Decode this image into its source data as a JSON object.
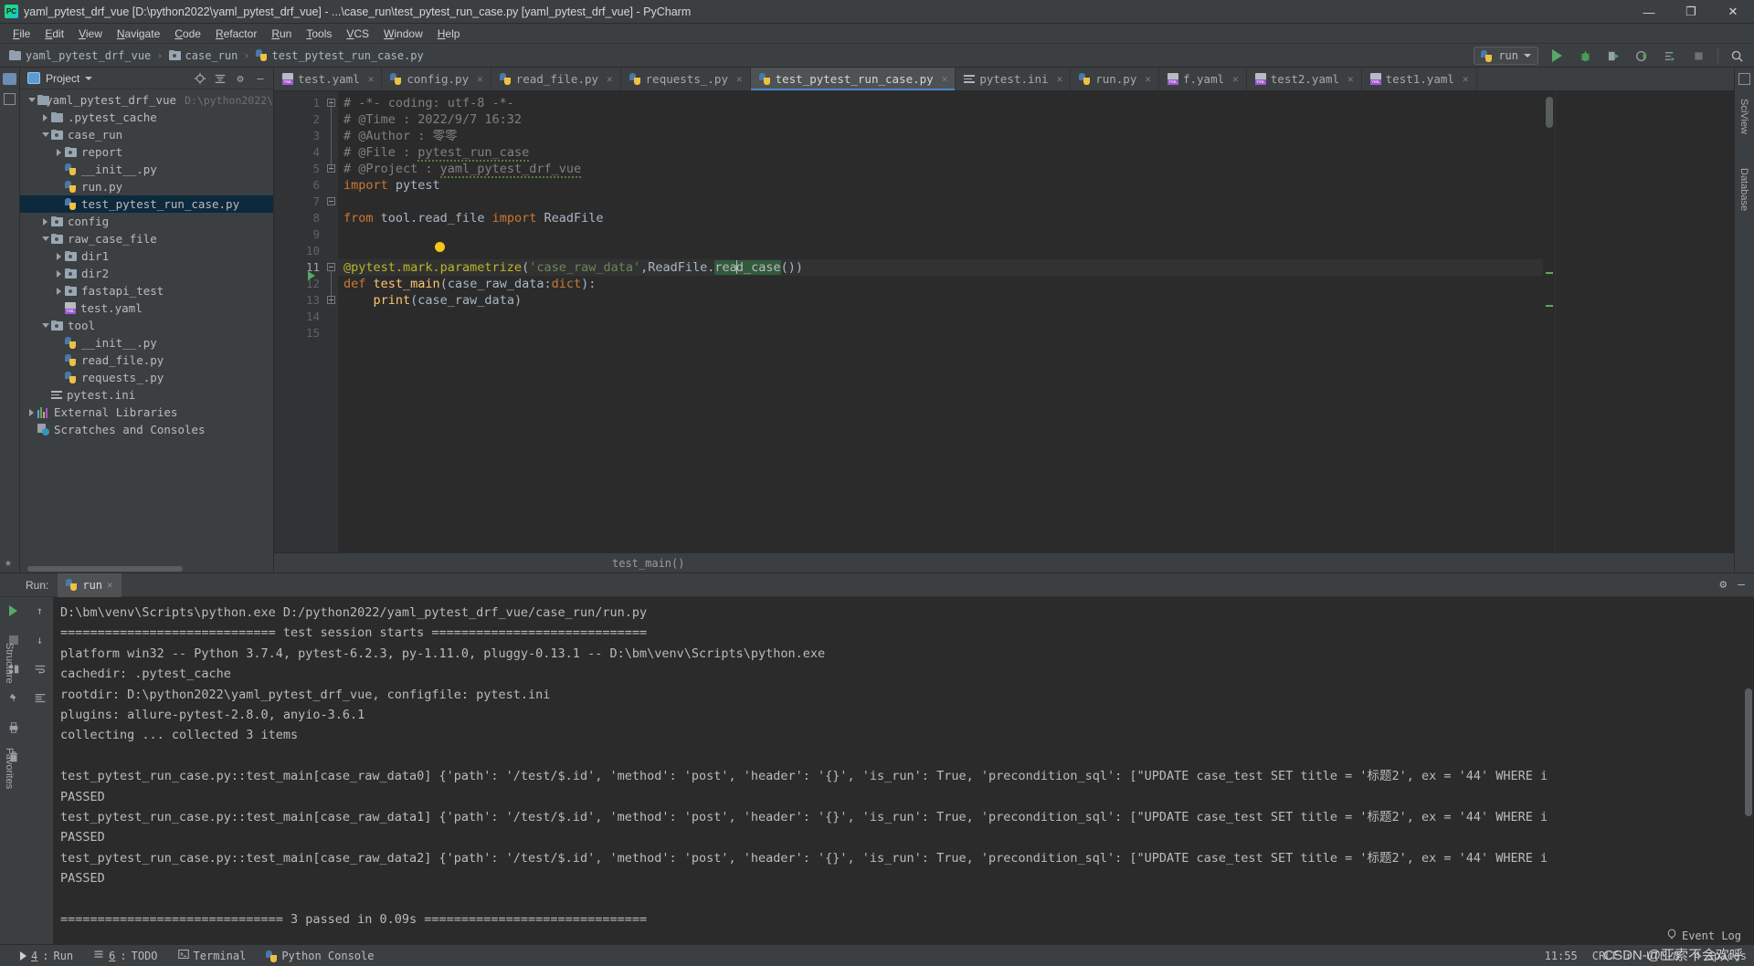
{
  "window": {
    "title": "yaml_pytest_drf_vue [D:\\python2022\\yaml_pytest_drf_vue] - ...\\case_run\\test_pytest_run_case.py [yaml_pytest_drf_vue] - PyCharm",
    "logo_text": "PC",
    "minimize": "—",
    "maximize": "❐",
    "close": "✕"
  },
  "menu": {
    "items": [
      "File",
      "Edit",
      "View",
      "Navigate",
      "Code",
      "Refactor",
      "Run",
      "Tools",
      "VCS",
      "Window",
      "Help"
    ]
  },
  "breadcrumb": {
    "items": [
      {
        "label": "yaml_pytest_drf_vue",
        "icon": "folder-icon"
      },
      {
        "label": "case_run",
        "icon": "source-folder-icon"
      },
      {
        "label": "test_pytest_run_case.py",
        "icon": "python-file-icon"
      }
    ],
    "separator": "›"
  },
  "toolbar": {
    "run_config": "run",
    "buttons": [
      "run-button",
      "debug-button",
      "run-coverage-button",
      "profile-button",
      "run-with-console-button",
      "stop-button",
      "search-everywhere-button"
    ]
  },
  "project_panel": {
    "title": "Project",
    "icons": [
      "locate-icon",
      "collapse-all-icon",
      "settings-gear-icon",
      "hide-icon"
    ],
    "tree": [
      {
        "depth": 0,
        "arrow": "open",
        "icon": "folder-icon",
        "label": "yaml_pytest_drf_vue",
        "path": "D:\\python2022\\",
        "selected": false
      },
      {
        "depth": 1,
        "arrow": "closed",
        "icon": "folder-icon",
        "label": ".pytest_cache",
        "path": "",
        "selected": false
      },
      {
        "depth": 1,
        "arrow": "open",
        "icon": "source-folder-icon",
        "label": "case_run",
        "path": "",
        "selected": false
      },
      {
        "depth": 2,
        "arrow": "closed",
        "icon": "source-folder-icon",
        "label": "report",
        "path": "",
        "selected": false
      },
      {
        "depth": 2,
        "arrow": "none",
        "icon": "python-file-icon",
        "label": "__init__.py",
        "path": "",
        "selected": false
      },
      {
        "depth": 2,
        "arrow": "none",
        "icon": "python-file-icon",
        "label": "run.py",
        "path": "",
        "selected": false
      },
      {
        "depth": 2,
        "arrow": "none",
        "icon": "python-file-icon",
        "label": "test_pytest_run_case.py",
        "path": "",
        "selected": true
      },
      {
        "depth": 1,
        "arrow": "closed",
        "icon": "source-folder-icon",
        "label": "config",
        "path": "",
        "selected": false
      },
      {
        "depth": 1,
        "arrow": "open",
        "icon": "source-folder-icon",
        "label": "raw_case_file",
        "path": "",
        "selected": false
      },
      {
        "depth": 2,
        "arrow": "closed",
        "icon": "source-folder-icon",
        "label": "dir1",
        "path": "",
        "selected": false
      },
      {
        "depth": 2,
        "arrow": "closed",
        "icon": "source-folder-icon",
        "label": "dir2",
        "path": "",
        "selected": false
      },
      {
        "depth": 2,
        "arrow": "closed",
        "icon": "source-folder-icon",
        "label": "fastapi_test",
        "path": "",
        "selected": false
      },
      {
        "depth": 2,
        "arrow": "none",
        "icon": "yaml-file-icon",
        "label": "test.yaml",
        "path": "",
        "selected": false
      },
      {
        "depth": 1,
        "arrow": "open",
        "icon": "source-folder-icon",
        "label": "tool",
        "path": "",
        "selected": false
      },
      {
        "depth": 2,
        "arrow": "none",
        "icon": "python-file-icon",
        "label": "__init__.py",
        "path": "",
        "selected": false
      },
      {
        "depth": 2,
        "arrow": "none",
        "icon": "python-file-icon",
        "label": "read_file.py",
        "path": "",
        "selected": false
      },
      {
        "depth": 2,
        "arrow": "none",
        "icon": "python-file-icon",
        "label": "requests_.py",
        "path": "",
        "selected": false
      },
      {
        "depth": 1,
        "arrow": "none",
        "icon": "ini-file-icon",
        "label": "pytest.ini",
        "path": "",
        "selected": false
      },
      {
        "depth": 0,
        "arrow": "closed",
        "icon": "library-icon",
        "label": "External Libraries",
        "path": "",
        "selected": false
      },
      {
        "depth": 0,
        "arrow": "none",
        "icon": "scratches-icon",
        "label": "Scratches and Consoles",
        "path": "",
        "selected": false
      }
    ]
  },
  "left_strip": {
    "labels": [
      "Structure",
      "Favorites"
    ]
  },
  "right_strip": {
    "labels": [
      "SciView",
      "Database"
    ]
  },
  "editor": {
    "tabs": [
      {
        "label": "test.yaml",
        "icon": "yaml-file-icon",
        "active": false
      },
      {
        "label": "config.py",
        "icon": "python-file-icon",
        "active": false
      },
      {
        "label": "read_file.py",
        "icon": "python-file-icon",
        "active": false
      },
      {
        "label": "requests_.py",
        "icon": "python-file-icon",
        "active": false
      },
      {
        "label": "test_pytest_run_case.py",
        "icon": "python-file-icon",
        "active": true
      },
      {
        "label": "pytest.ini",
        "icon": "ini-file-icon",
        "active": false
      },
      {
        "label": "run.py",
        "icon": "python-file-icon",
        "active": false
      },
      {
        "label": "f.yaml",
        "icon": "yaml-file-icon",
        "active": false
      },
      {
        "label": "test2.yaml",
        "icon": "yaml-file-icon",
        "active": false
      },
      {
        "label": "test1.yaml",
        "icon": "yaml-file-icon",
        "active": false
      }
    ],
    "close_glyph": "✕",
    "line_numbers": [
      "1",
      "2",
      "3",
      "4",
      "5",
      "6",
      "7",
      "8",
      "9",
      "10",
      "11",
      "12",
      "13",
      "14",
      "15"
    ],
    "current_line": "11",
    "lines": [
      "# -*- coding: utf-8 -*-",
      "# @Time : 2022/9/7 16:32",
      "# @Author : 零零",
      "# @File : pytest_run_case",
      "# @Project : yaml_pytest_drf_vue",
      "import pytest",
      "",
      "from tool.read_file import ReadFile",
      "",
      "",
      "@pytest.mark.parametrize('case_raw_data',ReadFile.read_case())",
      "def test_main(case_raw_data:dict):",
      "    print(case_raw_data)",
      "",
      ""
    ],
    "breadcrumb_bottom": "test_main()"
  },
  "run_panel": {
    "label": "Run:",
    "tab_label": "run",
    "close_glyph": "✕",
    "gutter_icons": [
      "rerun-icon",
      "scroll-up-icon",
      "stop-icon",
      "scroll-down-icon",
      "layout-icon",
      "soft-wrap-icon",
      "pin-icon",
      "print-icon",
      "trash-icon"
    ],
    "header_icons": [
      "settings-gear-icon",
      "hide-icon"
    ],
    "output": [
      "D:\\bm\\venv\\Scripts\\python.exe D:/python2022/yaml_pytest_drf_vue/case_run/run.py",
      "============================= test session starts =============================",
      "platform win32 -- Python 3.7.4, pytest-6.2.3, py-1.11.0, pluggy-0.13.1 -- D:\\bm\\venv\\Scripts\\python.exe",
      "cachedir: .pytest_cache",
      "rootdir: D:\\python2022\\yaml_pytest_drf_vue, configfile: pytest.ini",
      "plugins: allure-pytest-2.8.0, anyio-3.6.1",
      "collecting ... collected 3 items",
      "",
      "test_pytest_run_case.py::test_main[case_raw_data0] {'path': '/test/$.id', 'method': 'post', 'header': '{}', 'is_run': True, 'precondition_sql': [\"UPDATE case_test SET title = '标题2', ex = '44' WHERE i",
      "PASSED",
      "test_pytest_run_case.py::test_main[case_raw_data1] {'path': '/test/$.id', 'method': 'post', 'header': '{}', 'is_run': True, 'precondition_sql': [\"UPDATE case_test SET title = '标题2', ex = '44' WHERE i",
      "PASSED",
      "test_pytest_run_case.py::test_main[case_raw_data2] {'path': '/test/$.id', 'method': 'post', 'header': '{}', 'is_run': True, 'precondition_sql': [\"UPDATE case_test SET title = '标题2', ex = '44' WHERE i",
      "PASSED",
      "",
      "============================== 3 passed in 0.09s =============================="
    ]
  },
  "status_bar": {
    "left_items": [
      {
        "label": "Run",
        "number": "4",
        "icon": "run-tool-icon"
      },
      {
        "label": "TODO",
        "number": "6",
        "icon": "todo-icon"
      },
      {
        "label": "Terminal",
        "number": "",
        "icon": "terminal-icon"
      },
      {
        "label": "Python Console",
        "number": "",
        "icon": "python-console-icon"
      }
    ],
    "event_log": "Event Log",
    "event_log_icon": "balloon-icon",
    "caret_position": "11:55",
    "line_separator": "CRLF",
    "encoding": "UTF-8",
    "indent": "4 spaces",
    "watermark": "CSDN-@亚索不会欢呼"
  },
  "colors": {
    "bg": "#3c3f41",
    "editor_bg": "#2b2b2b",
    "accent": "#4a88c7",
    "green": "#59a869",
    "selected_row": "#0d293e"
  }
}
